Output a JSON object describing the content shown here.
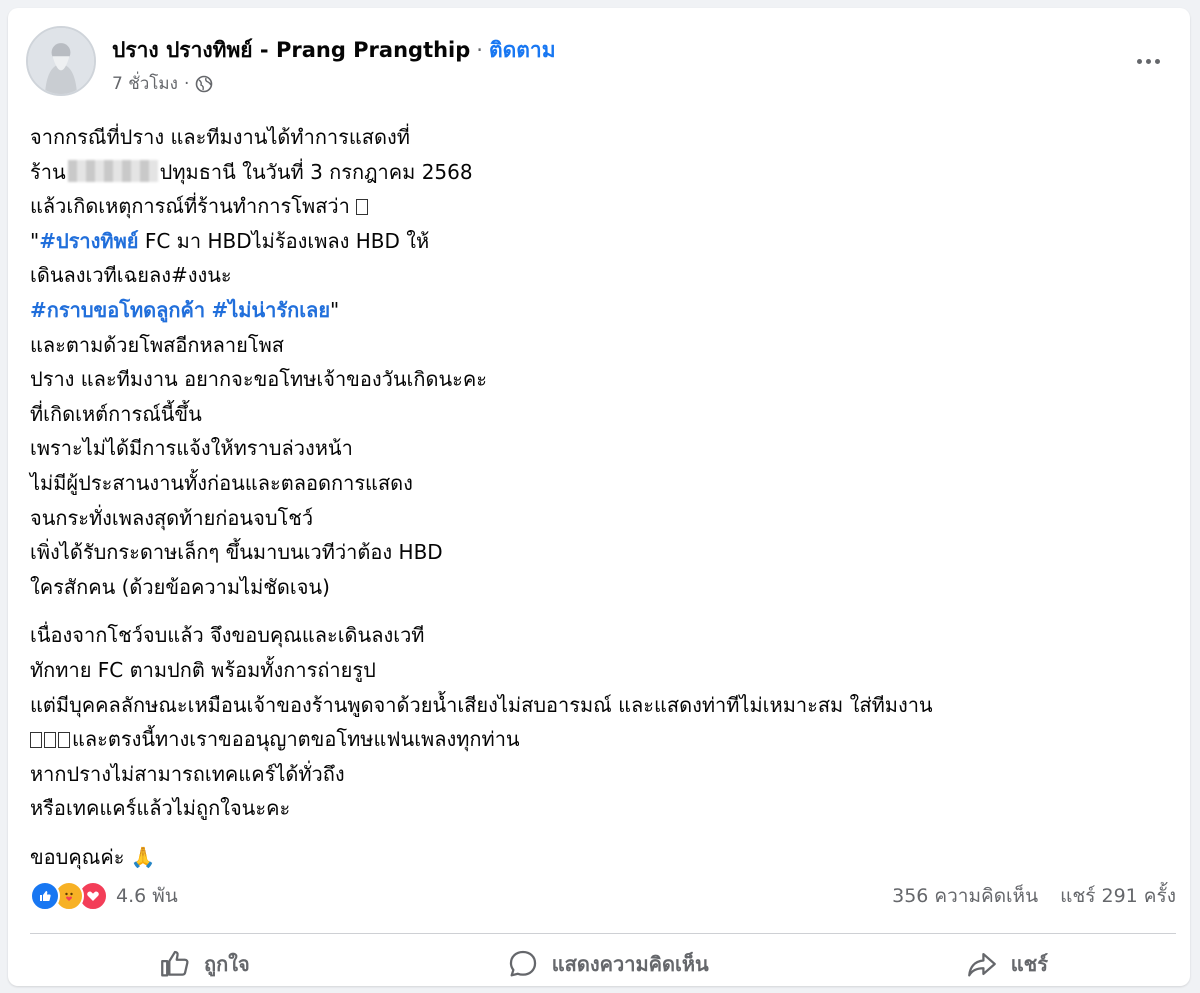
{
  "post": {
    "author": "ปราง ปรางทิพย์ - Prang Prangthip",
    "separator": "·",
    "follow_label": "ติดตาม",
    "time": "7 ชั่วโมง",
    "privacy_icon": "globe-icon",
    "more_icon": "more-options-icon",
    "body": {
      "l1": "จากกรณีที่ปราง และทีมงานได้ทำการแสดงที่",
      "l2a": "ร้าน",
      "l2b": "ปทุมธานี ในวันที่ 3 กรกฎาคม 2568",
      "l3": "แล้วเกิดเหตุการณ์ที่ร้านทำการโพสว่า",
      "l4_quote": "\"",
      "l4_tag": "#ปรางทิพย์",
      "l4_rest": " FC มา HBDไม่ร้องเพลง HBD ให้",
      "l5": "เดินลงเวทีเฉยลง#งงนะ",
      "l6_tag1": "#กราบขอโทดลูกค้า",
      "l6_tag2": "#ไม่น่ารักเลย",
      "l6_end": "\"",
      "l7": "และตามด้วยโพสอีกหลายโพส",
      "l8": "ปราง และทีมงาน อยากจะขอโทษเจ้าของวันเกิดนะคะ",
      "l9": "ที่เกิดเหต์การณ์นี้ขึ้น",
      "l10": "เพราะไม่ได้มีการแจ้งให้ทราบล่วงหน้า",
      "l11": "ไม่มีผู้ประสานงานทั้งก่อนและตลอดการแสดง",
      "l12": "จนกระทั่งเพลงสุดท้ายก่อนจบโชว์",
      "l13": "เพิ่งได้รับกระดาษเล็กๆ ขึ้นมาบนเวทีว่าต้อง HBD",
      "l14": "ใครสักคน (ด้วยข้อความไม่ชัดเจน)",
      "l15": "เนื่องจากโชว์จบแล้ว จึงขอบคุณและเดินลงเวที",
      "l16": "ทักทาย FC ตามปกติ พร้อมทั้งการถ่ายรูป",
      "l17": "แต่มีบุคคลลักษณะเหมือนเจ้าของร้านพูดจาด้วยน้ำเสียงไม่สบอารมณ์ และแสดงท่าทีไม่เหมาะสม ใส่ทีมงาน",
      "l18": "และตรงนี้ทางเราขออนุญาตขอโทษแฟนเพลงทุกท่าน",
      "l19": "หากปรางไม่สามารถเทคแคร์ได้ทั่วถึง",
      "l20": "หรือเทคแคร์แล้วไม่ถูกใจนะคะ",
      "l21": "ขอบคุณค่ะ",
      "l21_emoji": "🙏"
    }
  },
  "stats": {
    "reaction_icons": [
      "like-reaction-icon",
      "care-reaction-icon",
      "love-reaction-icon"
    ],
    "reaction_count": "4.6 พัน",
    "comments": "356 ความคิดเห็น",
    "shares": "แชร์ 291 ครั้ง"
  },
  "actions": {
    "like": "ถูกใจ",
    "comment": "แสดงความคิดเห็น",
    "share": "แชร์"
  },
  "colors": {
    "link": "#1877f2",
    "hashtag": "#216fdb",
    "secondary_text": "#65676b",
    "like": "#1877f2",
    "love": "#f33e58",
    "care": "#f7b125"
  }
}
